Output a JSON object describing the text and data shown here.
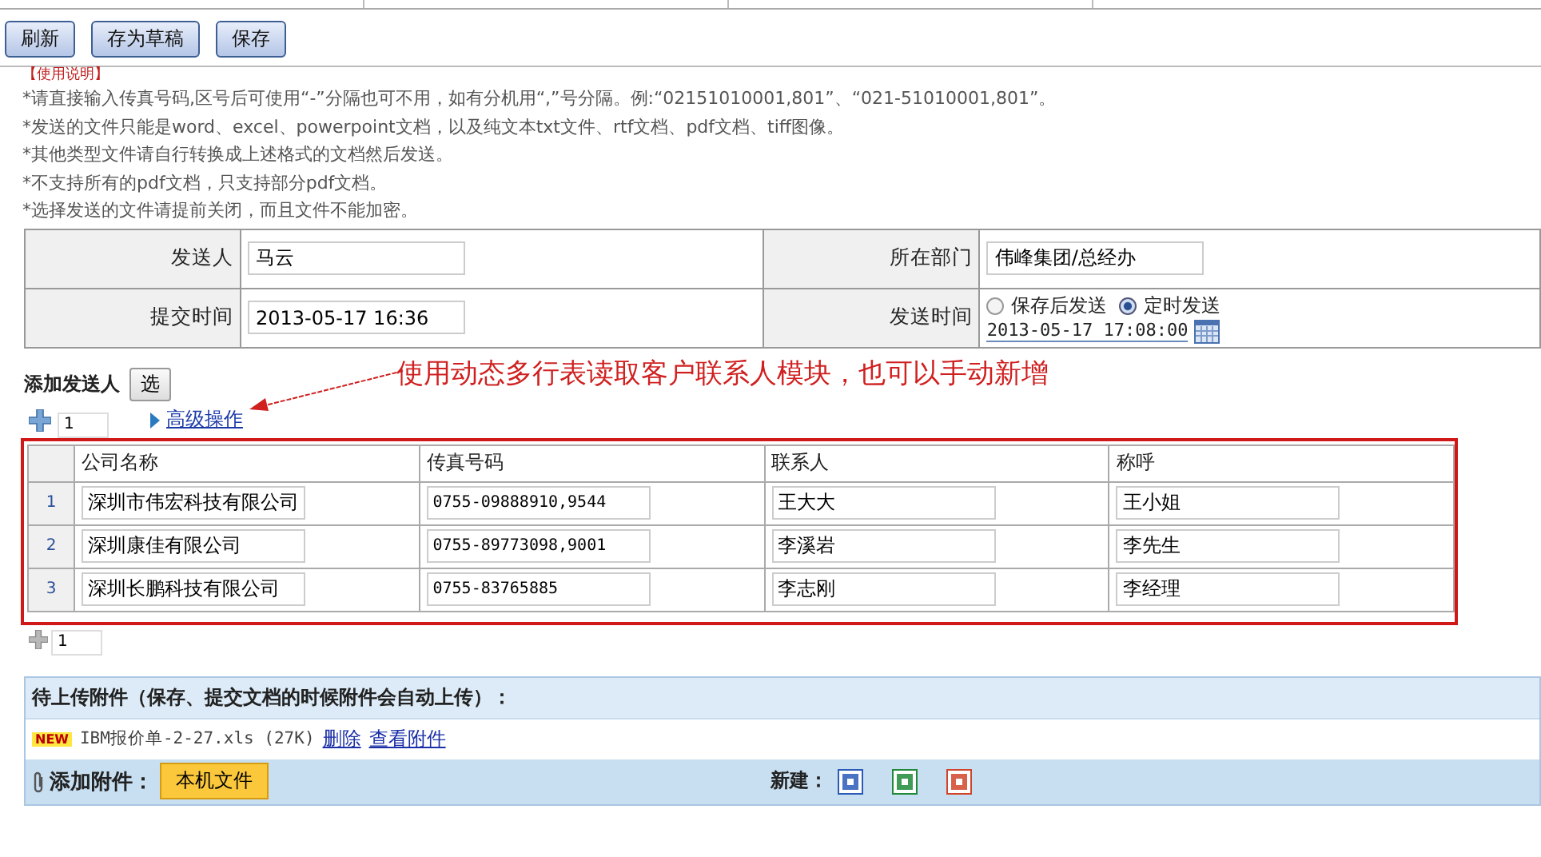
{
  "toolbar": {
    "buttons": [
      "刷新",
      "存为草稿",
      "保存"
    ]
  },
  "instructions": {
    "title": "【使用说明】",
    "lines": [
      "*请直接输入传真号码,区号后可使用“-”分隔也可不用，如有分机用“,”号分隔。例:“02151010001,801”、“021-51010001,801”。",
      "*发送的文件只能是word、excel、powerpoint文档，以及纯文本txt文件、rtf文档、pdf文档、tiff图像。",
      "*其他类型文件请自行转换成上述格式的文档然后发送。",
      "*不支持所有的pdf文档，只支持部分pdf文档。",
      "*选择发送的文件请提前关闭，而且文件不能加密。"
    ]
  },
  "form": {
    "fields": [
      {
        "kind": "text",
        "label": "发送人",
        "value": "马云"
      },
      {
        "kind": "text",
        "label": "所在部门",
        "value": "伟峰集团/总经办"
      },
      {
        "kind": "text",
        "label": "提交时间",
        "value": "2013-05-17 16:36"
      },
      {
        "kind": "schedule",
        "label": "发送时间",
        "options": [
          {
            "label": "保存后发送",
            "selected": false
          },
          {
            "label": "定时发送",
            "selected": true
          }
        ],
        "value": "2013-05-17 17:08:00"
      }
    ]
  },
  "recipients": {
    "label": "添加发送人",
    "select_button": "选",
    "annotation": "使用动态多行表读取客户联系人模块，也可以手动新增",
    "add_count": "1",
    "advanced_link": "高级操作",
    "columns": [
      "公司名称",
      "传真号码",
      "联系人",
      "称呼"
    ],
    "rows": [
      {
        "index": "1",
        "cells": [
          "深圳市伟宏科技有限公司",
          "0755-09888910,9544",
          "王大大",
          "王小姐"
        ]
      },
      {
        "index": "2",
        "cells": [
          "深圳康佳有限公司",
          "0755-89773098,9001",
          "李溪岩",
          "李先生"
        ]
      },
      {
        "index": "3",
        "cells": [
          "深圳长鹏科技有限公司",
          "0755-83765885",
          "李志刚",
          "李经理"
        ]
      }
    ],
    "footer_count": "1"
  },
  "attachments": {
    "title": "待上传附件（保存、提交文档的时候附件会自动上传）：",
    "files": [
      {
        "badge": "NEW",
        "name": "IBM报价单-2-27.xls (27K)",
        "actions": [
          "删除",
          "查看附件"
        ]
      }
    ],
    "add_label": "添加附件：",
    "local_button": "本机文件",
    "new_label": "新建："
  }
}
